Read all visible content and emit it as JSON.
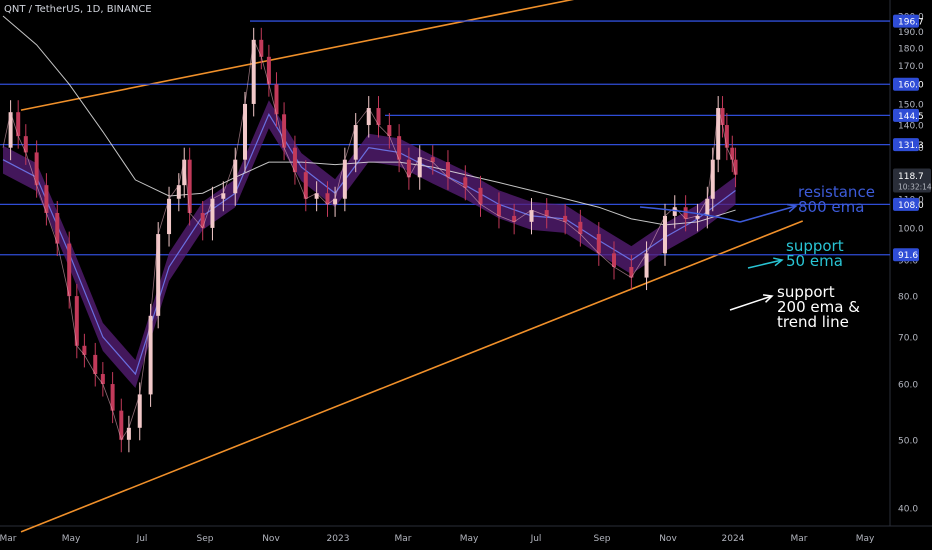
{
  "header": {
    "symbol_title": "QNT / TetherUS, 1D, BINANCE"
  },
  "annotations": {
    "resistance": {
      "line1": "resistance",
      "line2": "800 ema"
    },
    "support_50": {
      "line1": "support",
      "line2": "50 ema"
    },
    "support_200": {
      "line1": "support",
      "line2": "200 ema &",
      "line3": "trend line"
    }
  },
  "colors": {
    "background": "#000000",
    "horizontal_level": "#2f4dd6",
    "trend_channel": "#f0902a",
    "ema_200": "#e6e6e6",
    "ema_band": "#5a1f7a",
    "ema_50": "#6a6fe0",
    "candle": "#f2c9c9",
    "candle_alt": "#c23a5a",
    "axis_text": "#b2b5be",
    "price_label_bg": "#2f4dd6",
    "current_price_bg": "#2a2e39",
    "arrow_blue": "#3d5bd9",
    "arrow_cyan": "#29c4d4",
    "arrow_white": "#ffffff"
  },
  "chart_data": {
    "type": "candlestick",
    "title": "QNT / TetherUS, 1D, BINANCE",
    "x_tick_labels": [
      "Mar",
      "May",
      "Jul",
      "Sep",
      "Nov",
      "2023",
      "Mar",
      "May",
      "Jul",
      "Sep",
      "Nov",
      "2024",
      "Mar",
      "May"
    ],
    "y_tick_labels": [
      "200.0",
      "190.0",
      "180.0",
      "170.0",
      "150.0",
      "140.0",
      "130.0",
      "120.0",
      "110.0",
      "100.0",
      "90.0",
      "80.0",
      "70.0",
      "60.0",
      "50.0",
      "40.0"
    ],
    "horizontal_levels": [
      196.7,
      160.0,
      144.5,
      131.3,
      108.0,
      91.6
    ],
    "current_price": {
      "value": "118.7",
      "countdown": "10:32:14"
    },
    "price_series": [
      [
        "2022-03-01",
        130
      ],
      [
        "2022-03-08",
        146
      ],
      [
        "2022-03-15",
        135
      ],
      [
        "2022-03-22",
        128
      ],
      [
        "2022-04-01",
        115
      ],
      [
        "2022-04-10",
        105
      ],
      [
        "2022-04-20",
        95
      ],
      [
        "2022-05-01",
        80
      ],
      [
        "2022-05-08",
        68
      ],
      [
        "2022-05-15",
        66
      ],
      [
        "2022-05-25",
        62
      ],
      [
        "2022-06-01",
        60
      ],
      [
        "2022-06-10",
        55
      ],
      [
        "2022-06-18",
        50
      ],
      [
        "2022-06-25",
        52
      ],
      [
        "2022-07-05",
        58
      ],
      [
        "2022-07-15",
        75
      ],
      [
        "2022-07-22",
        98
      ],
      [
        "2022-08-01",
        110
      ],
      [
        "2022-08-10",
        115
      ],
      [
        "2022-08-15",
        125
      ],
      [
        "2022-08-20",
        105
      ],
      [
        "2022-09-01",
        100
      ],
      [
        "2022-09-10",
        110
      ],
      [
        "2022-09-20",
        112
      ],
      [
        "2022-10-01",
        125
      ],
      [
        "2022-10-10",
        150
      ],
      [
        "2022-10-18",
        185
      ],
      [
        "2022-10-25",
        175
      ],
      [
        "2022-11-01",
        160
      ],
      [
        "2022-11-08",
        145
      ],
      [
        "2022-11-15",
        130
      ],
      [
        "2022-11-25",
        120
      ],
      [
        "2022-12-05",
        110
      ],
      [
        "2022-12-15",
        112
      ],
      [
        "2022-12-25",
        108
      ],
      [
        "2023-01-01",
        110
      ],
      [
        "2023-01-10",
        125
      ],
      [
        "2023-01-20",
        140
      ],
      [
        "2023-02-01",
        148
      ],
      [
        "2023-02-10",
        140
      ],
      [
        "2023-02-20",
        135
      ],
      [
        "2023-03-01",
        125
      ],
      [
        "2023-03-10",
        118
      ],
      [
        "2023-03-20",
        126
      ],
      [
        "2023-04-01",
        124
      ],
      [
        "2023-04-15",
        118
      ],
      [
        "2023-05-01",
        114
      ],
      [
        "2023-05-15",
        108
      ],
      [
        "2023-06-01",
        104
      ],
      [
        "2023-06-15",
        102
      ],
      [
        "2023-07-01",
        106
      ],
      [
        "2023-07-15",
        104
      ],
      [
        "2023-08-01",
        102
      ],
      [
        "2023-08-15",
        98
      ],
      [
        "2023-09-01",
        92
      ],
      [
        "2023-09-15",
        88
      ],
      [
        "2023-10-01",
        85
      ],
      [
        "2023-10-15",
        92
      ],
      [
        "2023-11-01",
        104
      ],
      [
        "2023-11-10",
        107
      ],
      [
        "2023-11-20",
        103
      ],
      [
        "2023-12-01",
        104
      ],
      [
        "2023-12-10",
        110
      ],
      [
        "2023-12-15",
        125
      ],
      [
        "2023-12-20",
        148
      ],
      [
        "2023-12-24",
        140
      ],
      [
        "2023-12-28",
        130
      ],
      [
        "2024-01-02",
        125
      ],
      [
        "2024-01-05",
        119
      ]
    ],
    "ema_200": [
      [
        "2022-03-01",
        200
      ],
      [
        "2022-04-01",
        182
      ],
      [
        "2022-05-01",
        160
      ],
      [
        "2022-06-01",
        137
      ],
      [
        "2022-07-01",
        117
      ],
      [
        "2022-08-01",
        111
      ],
      [
        "2022-09-01",
        112
      ],
      [
        "2022-10-01",
        118
      ],
      [
        "2022-11-01",
        124
      ],
      [
        "2022-12-01",
        124
      ],
      [
        "2023-01-01",
        123
      ],
      [
        "2023-02-01",
        124
      ],
      [
        "2023-03-01",
        124
      ],
      [
        "2023-04-01",
        122
      ],
      [
        "2023-05-01",
        119
      ],
      [
        "2023-06-01",
        116
      ],
      [
        "2023-07-01",
        113
      ],
      [
        "2023-08-01",
        110
      ],
      [
        "2023-09-01",
        107
      ],
      [
        "2023-10-01",
        103
      ],
      [
        "2023-11-01",
        101
      ],
      [
        "2023-12-01",
        102
      ],
      [
        "2024-01-05",
        106
      ]
    ],
    "ema_50": [
      [
        "2022-03-01",
        125
      ],
      [
        "2022-04-01",
        118
      ],
      [
        "2022-05-01",
        92
      ],
      [
        "2022-06-01",
        70
      ],
      [
        "2022-07-01",
        62
      ],
      [
        "2022-08-01",
        88
      ],
      [
        "2022-09-01",
        104
      ],
      [
        "2022-10-01",
        112
      ],
      [
        "2022-11-01",
        145
      ],
      [
        "2022-12-01",
        122
      ],
      [
        "2023-01-01",
        112
      ],
      [
        "2023-02-01",
        130
      ],
      [
        "2023-03-01",
        128
      ],
      [
        "2023-04-01",
        121
      ],
      [
        "2023-05-01",
        115
      ],
      [
        "2023-06-01",
        108
      ],
      [
        "2023-07-01",
        104
      ],
      [
        "2023-08-01",
        103
      ],
      [
        "2023-09-01",
        96
      ],
      [
        "2023-10-01",
        90
      ],
      [
        "2023-11-01",
        97
      ],
      [
        "2023-12-01",
        103
      ],
      [
        "2024-01-05",
        113
      ]
    ],
    "trend_channel": {
      "upper": [
        [
          "2022-03-01",
          147
        ],
        [
          "2024-05-15",
          252
        ]
      ],
      "lower": [
        [
          "2022-03-01",
          37
        ],
        [
          "2024-05-15",
          105
        ]
      ]
    }
  }
}
